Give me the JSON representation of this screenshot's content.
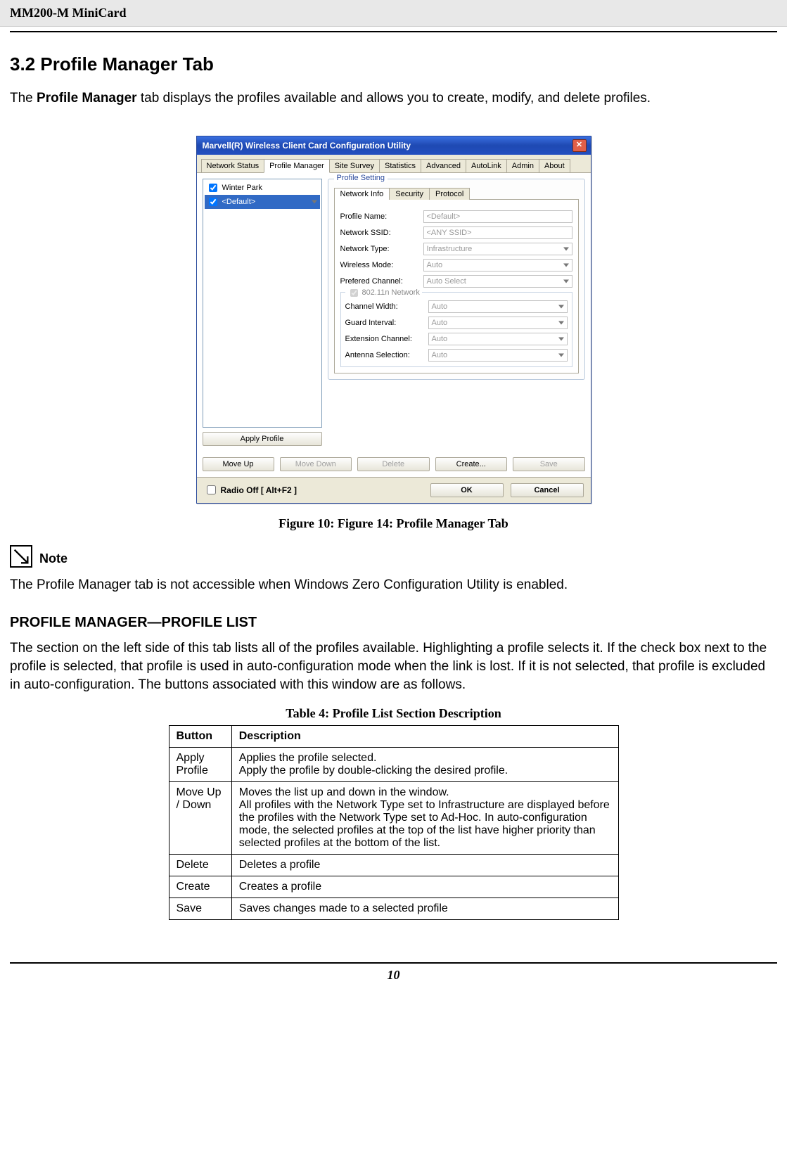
{
  "header": {
    "product": "MM200-M MiniCard"
  },
  "section": {
    "title": "3.2 Profile Manager Tab",
    "intro_prefix": "The ",
    "intro_bold": "Profile Manager",
    "intro_suffix": " tab displays the profiles available and allows you to create, modify, and delete profiles."
  },
  "figure": {
    "caption": "Figure 10: Figure 14: Profile Manager Tab"
  },
  "note": {
    "label": "Note",
    "text": "The Profile Manager tab is not accessible when Windows Zero Configuration Utility is enabled."
  },
  "profile_list_section": {
    "heading": "PROFILE MANAGER—PROFILE LIST",
    "text": "The section on the left side of this tab lists all of the profiles available. Highlighting a profile selects it. If the check box next to the profile is selected, that profile is used in auto-configuration mode when the link is lost. If it is not selected, that profile is excluded in auto-configuration. The buttons associated with this window are as follows."
  },
  "table": {
    "caption": "Table 4: Profile List Section Description",
    "headers": {
      "c1": "Button",
      "c2": "Description"
    },
    "rows": [
      {
        "c1": "Apply Profile",
        "c2": "Applies the profile selected.\nApply the profile by double-clicking the desired profile."
      },
      {
        "c1": "Move Up / Down",
        "c2": "Moves the list up and down in the window.\nAll profiles with the Network Type set to Infrastructure are displayed before the profiles with the Network Type set to Ad-Hoc. In auto-configuration mode, the selected profiles at the top of the list have higher priority than selected profiles at the bottom of the list."
      },
      {
        "c1": "Delete",
        "c2": "Deletes a profile"
      },
      {
        "c1": "Create",
        "c2": "Creates a profile"
      },
      {
        "c1": "Save",
        "c2": "Saves changes made to a selected profile"
      }
    ]
  },
  "footer": {
    "page": "10"
  },
  "dialog": {
    "title": "Marvell(R) Wireless Client Card Configuration Utility",
    "tabs": [
      "Network Status",
      "Profile Manager",
      "Site Survey",
      "Statistics",
      "Advanced",
      "AutoLink",
      "Admin",
      "About"
    ],
    "active_tab_index": 1,
    "profile_items": [
      {
        "checked": true,
        "label": "Winter Park",
        "selected": false
      },
      {
        "checked": true,
        "label": "<Default>",
        "selected": true
      }
    ],
    "apply_profile_btn": "Apply Profile",
    "profile_setting_legend": "Profile Setting",
    "inner_tabs": [
      "Network Info",
      "Security",
      "Protocol"
    ],
    "inner_active_index": 0,
    "fields": {
      "profile_name": {
        "label": "Profile Name:",
        "value": "<Default>"
      },
      "network_ssid": {
        "label": "Network SSID:",
        "value": "<ANY SSID>"
      },
      "network_type": {
        "label": "Network Type:",
        "value": "Infrastructure"
      },
      "wireless_mode": {
        "label": "Wireless Mode:",
        "value": "Auto"
      },
      "prefered_channel": {
        "label": "Prefered Channel:",
        "value": "Auto Select"
      }
    },
    "sub_legend": "802.11n Network",
    "sub_fields": {
      "channel_width": {
        "label": "Channel Width:",
        "value": "Auto"
      },
      "guard_interval": {
        "label": "Guard Interval:",
        "value": "Auto"
      },
      "extension_channel": {
        "label": "Extension Channel:",
        "value": "Auto"
      },
      "antenna_selection": {
        "label": "Antenna Selection:",
        "value": "Auto"
      }
    },
    "action_buttons": {
      "move_up": "Move Up",
      "move_down": "Move Down",
      "delete": "Delete",
      "create": "Create...",
      "save": "Save"
    },
    "radio_off": "Radio Off  [ Alt+F2 ]",
    "ok": "OK",
    "cancel": "Cancel"
  }
}
